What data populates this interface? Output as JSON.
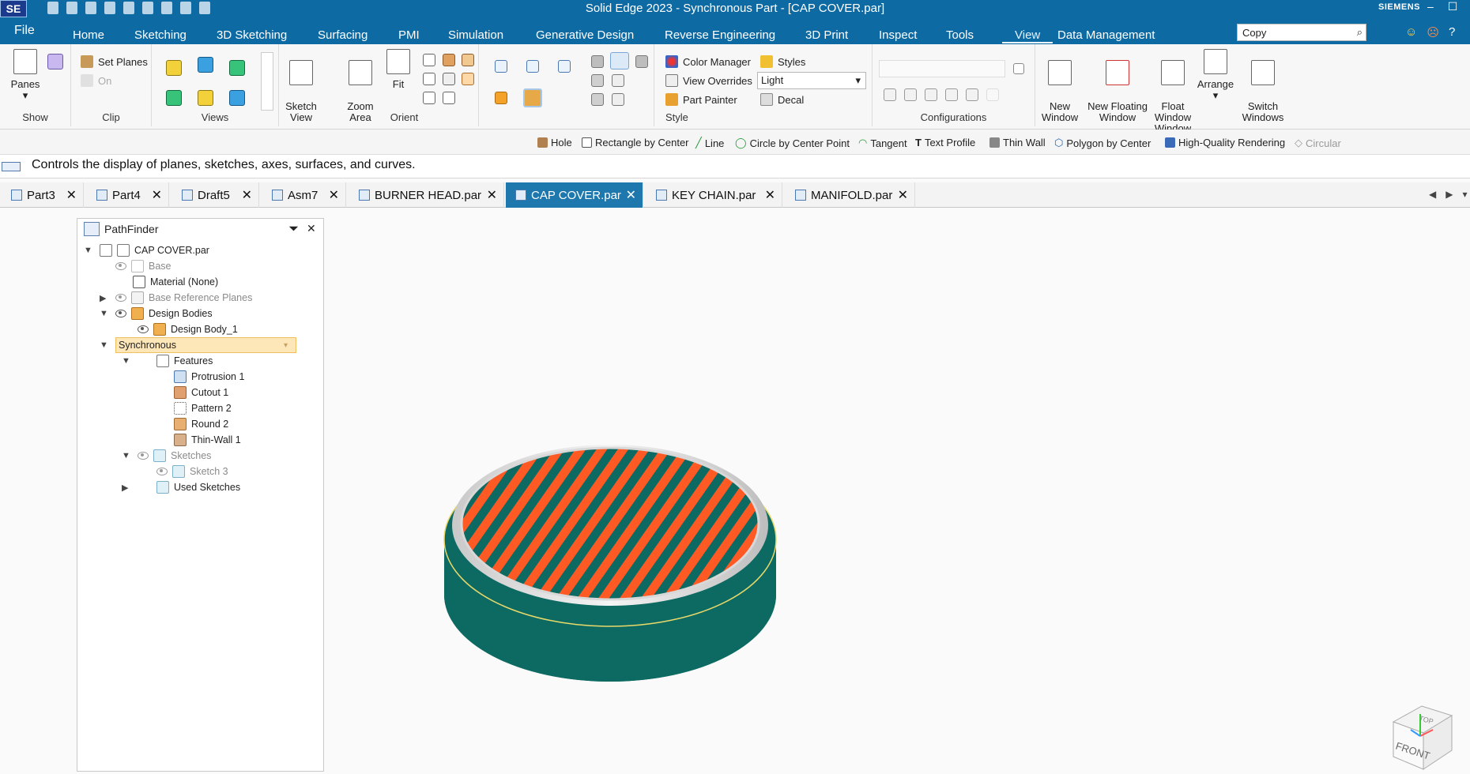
{
  "app": {
    "logo": "SE",
    "title": "Solid Edge 2023 - Synchronous Part - [CAP COVER.par]",
    "vendor": "SIEMENS",
    "window_controls": [
      "–",
      "☐",
      "?"
    ]
  },
  "menu": {
    "items": [
      "File",
      "Home",
      "Sketching",
      "3D Sketching",
      "Surfacing",
      "PMI",
      "Simulation",
      "Generative Design",
      "Reverse Engineering",
      "3D Print",
      "Inspect",
      "Tools",
      "View",
      "Data Management"
    ],
    "active": "View",
    "search_value": "Copy"
  },
  "ribbon": {
    "show": {
      "panes": "Panes",
      "label": "Show"
    },
    "clip": {
      "set_planes": "Set Planes",
      "on": "On",
      "label": "Clip"
    },
    "views": {
      "label": "Views",
      "sketch_view": "Sketch\nView"
    },
    "orient": {
      "zoom_area": "Zoom\nArea",
      "fit": "Fit",
      "label": "Orient"
    },
    "style": {
      "color_manager": "Color Manager",
      "styles": "Styles",
      "view_overrides": "View Overrides",
      "override_value": "Light",
      "part_painter": "Part Painter",
      "decal": "Decal",
      "label": "Style"
    },
    "configurations": {
      "label": "Configurations"
    },
    "window": {
      "new_window": "New\nWindow",
      "new_floating_window": "New Floating\nWindow",
      "float_window": "Float\nWindow\nWindow",
      "arrange": "Arrange",
      "switch_windows": "Switch\nWindows"
    }
  },
  "command_bar": [
    "Hole",
    "Rectangle by Center",
    "Line",
    "Circle by Center Point",
    "Tangent",
    "Text Profile",
    "Thin Wall",
    "Polygon by Center",
    "High-Quality Rendering",
    "Circular"
  ],
  "prompt": "Controls the display of planes, sketches, axes, surfaces, and curves.",
  "doc_tabs": [
    "Part3",
    "Part4",
    "Draft5",
    "Asm7",
    "BURNER HEAD.par",
    "CAP COVER.par",
    "KEY CHAIN.par",
    "MANIFOLD.par"
  ],
  "active_tab": "CAP COVER.par",
  "pathfinder": {
    "title": "PathFinder",
    "tree": {
      "root": "CAP COVER.par",
      "base": "Base",
      "material": "Material (None)",
      "base_ref_planes": "Base Reference Planes",
      "design_bodies": "Design Bodies",
      "design_body_1": "Design Body_1",
      "synchronous": "Synchronous",
      "features": "Features",
      "protrusion": "Protrusion 1",
      "cutout": "Cutout 1",
      "pattern": "Pattern 2",
      "round": "Round 2",
      "thinwall": "Thin-Wall 1",
      "sketches": "Sketches",
      "sketch3": "Sketch 3",
      "used_sketches": "Used Sketches"
    }
  },
  "viewcube": {
    "top": "TOP",
    "front": "FRONT"
  },
  "colors": {
    "accent": "#0e6aa3",
    "part_teal": "#0d6a62",
    "part_orange": "#ff5a24",
    "highlight": "#fde6b8"
  }
}
